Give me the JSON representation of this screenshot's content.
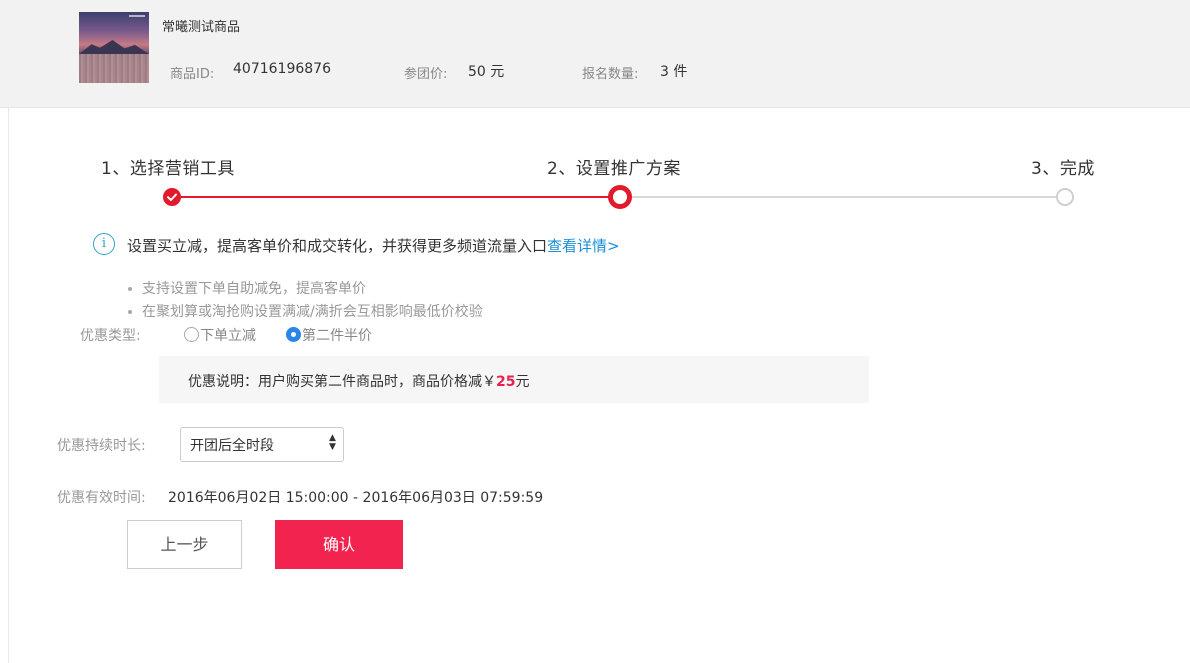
{
  "product": {
    "title": "常曦测试商品",
    "id_label": "商品ID:",
    "id_value": "40716196876",
    "price_label": "参团价:",
    "price_value": "50 元",
    "qty_label": "报名数量:",
    "qty_value": "3 件"
  },
  "steps": [
    {
      "label": "1、选择营销工具",
      "state": "done"
    },
    {
      "label": "2、设置推广方案",
      "state": "current"
    },
    {
      "label": "3、完成",
      "state": "pending"
    }
  ],
  "colors": {
    "accent": "#f3234f",
    "step_active": "#e21a2c",
    "link": "#1a8fd8",
    "info": "#2fa3c9",
    "radio": "#2b84ea"
  },
  "info": {
    "icon": "info-icon",
    "text": "设置买立减，提高客单价和成交转化，并获得更多频道流量入口",
    "link": "查看详情>"
  },
  "bullets": [
    "支持设置下单自助减免，提高客单价",
    "在聚划算或淘抢购设置满减/满折会互相影响最低价校验"
  ],
  "discount_type": {
    "label": "优惠类型:",
    "options": [
      {
        "label": "下单立减",
        "selected": false
      },
      {
        "label": "第二件半价",
        "selected": true
      }
    ]
  },
  "explain": {
    "prefix": "优惠说明：用户购买第二件商品时，商品价格减￥",
    "amount": "25",
    "suffix": "元"
  },
  "duration": {
    "label": "优惠持续时长:",
    "selected": "开团后全时段"
  },
  "valid": {
    "label": "优惠有效时间:",
    "value": "2016年06月02日 15:00:00 - 2016年06月03日 07:59:59"
  },
  "buttons": {
    "prev": "上一步",
    "confirm": "确认"
  }
}
